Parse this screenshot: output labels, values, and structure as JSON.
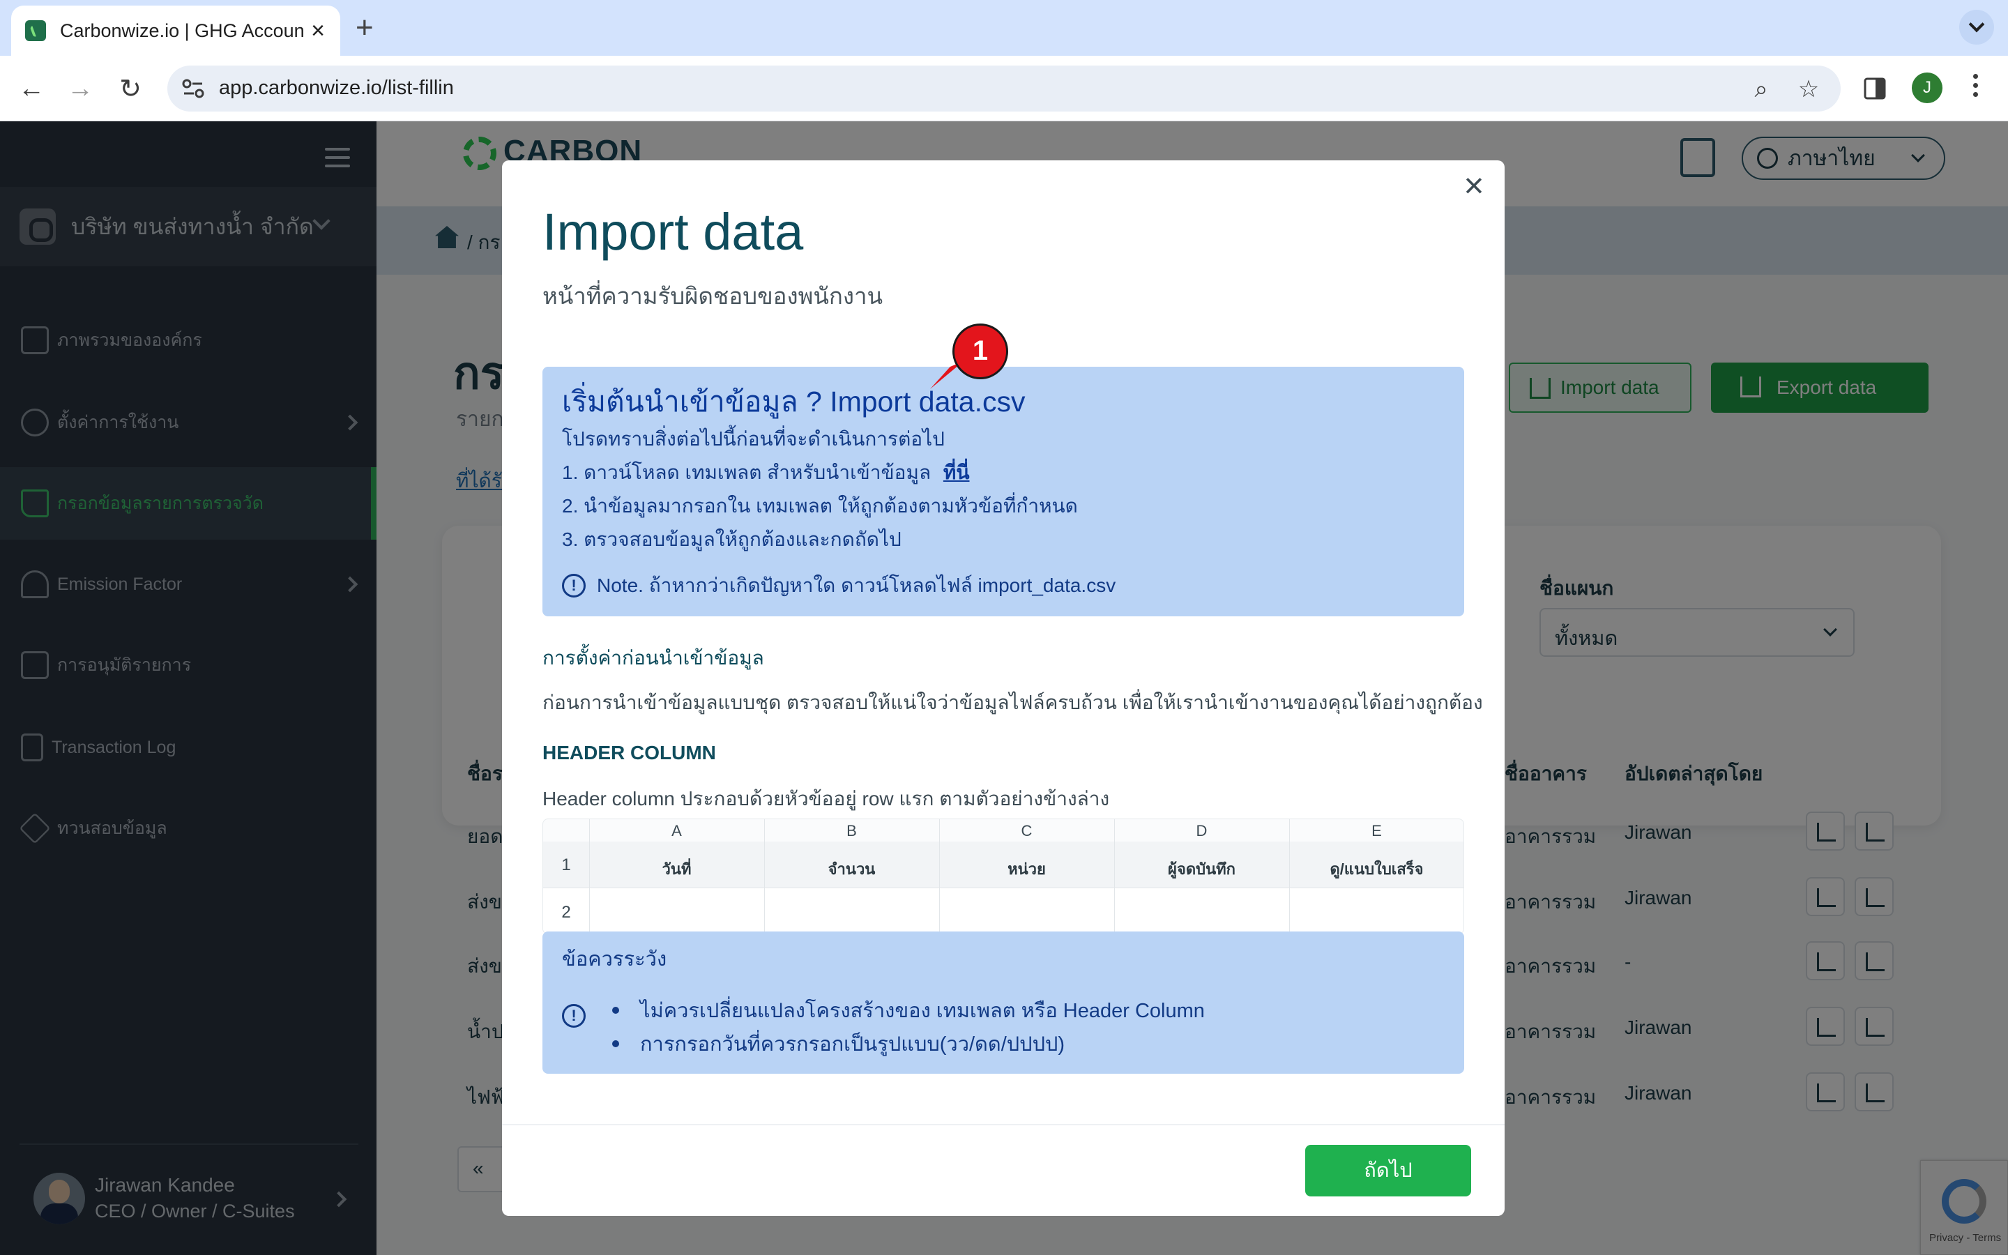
{
  "browser": {
    "tab_title": "Carbonwize.io | GHG Accoun",
    "url": "app.carbonwize.io/list-fillin",
    "profile_initial": "J"
  },
  "sidebar": {
    "company": "บริษัท ขนส่งทางน้ำ จำกัด",
    "items": [
      {
        "label": "ภาพรวมขององค์กร",
        "has_arrow": false
      },
      {
        "label": "ตั้งค่าการใช้งาน",
        "has_arrow": true
      },
      {
        "label": "กรอกข้อมูลรายการตรวจวัด",
        "has_arrow": false,
        "active": true
      },
      {
        "label": "Emission Factor",
        "has_arrow": true
      },
      {
        "label": "การอนุมัติรายการ",
        "has_arrow": false
      },
      {
        "label": "Transaction Log",
        "has_arrow": false
      },
      {
        "label": "ทวนสอบข้อมูล",
        "has_arrow": false
      }
    ],
    "user": {
      "name": "Jirawan Kandee",
      "role": "CEO / Owner / C-Suites"
    }
  },
  "header": {
    "brand": "CARBON",
    "language": "ภาษาไทย",
    "breadcrumb": "/ กร"
  },
  "page": {
    "title": "กร",
    "subtitle": "รายก",
    "link": "ที่ได้รับ",
    "import_button": "Import data",
    "export_button": "Export data",
    "filter_label": "ชื่อแผนก",
    "filter_value": "ทั้งหมด",
    "columns": [
      "ชื่อรา",
      "ชื่ออาคาร",
      "อัปเดตล่าสุดโดย"
    ],
    "rows": [
      {
        "name": "ยอด",
        "building": "อาคารรวม",
        "updated_by": "Jirawan"
      },
      {
        "name": "ส่งข",
        "building": "อาคารรวม",
        "updated_by": "Jirawan"
      },
      {
        "name": "ส่งข",
        "building": "อาคารรวม",
        "updated_by": "-"
      },
      {
        "name": "น้ำป",
        "building": "อาคารรวม",
        "updated_by": "Jirawan"
      },
      {
        "name": "ไฟฟ้",
        "building": "อาคารรวม",
        "updated_by": "Jirawan"
      }
    ],
    "pager_first": "«"
  },
  "modal": {
    "title": "Import data",
    "subtitle": "หน้าที่ความรับผิดชอบของพนักงาน",
    "info": {
      "title": "เริ่มต้นนำเข้าข้อมูล ? Import data.csv",
      "intro": "โปรดทราบสิ่งต่อไปนี้ก่อนที่จะดำเนินการต่อไป",
      "step1": "1. ดาวน์โหลด เทมเพลต สำหรับนำเข้าข้อมูล",
      "step1_link": "ที่นี่",
      "step2": "2. นำข้อมูลมากรอกใน เทมเพลต ให้ถูกต้องตามหัวข้อที่กำหนด",
      "step3": "3. ตรวจสอบข้อมูลให้ถูกต้องและกดถัดไป",
      "note": "Note. ถ้าหากว่าเกิดปัญหาใด ดาวน์โหลดไฟล์ import_data.csv"
    },
    "marker": "1",
    "settings_title": "การตั้งค่าก่อนนำเข้าข้อมูล",
    "settings_text": "ก่อนการนำเข้าข้อมูลแบบชุด ตรวจสอบให้แน่ใจว่าข้อมูลไฟล์ครบถ้วน เพื่อให้เรานำเข้างานของคุณได้อย่างถูกต้อง",
    "header_column_title": "HEADER COLUMN",
    "header_column_text": "Header column ประกอบด้วยหัวข้ออยู่ row แรก ตามตัวอย่างข้างล่าง",
    "sheet": {
      "letters": [
        "A",
        "B",
        "C",
        "D",
        "E"
      ],
      "row_numbers": [
        "1",
        "2"
      ],
      "headers": [
        "วันที่",
        "จำนวน",
        "หน่วย",
        "ผู้จดบันทึก",
        "ดู/แนบใบเสร็จ"
      ]
    },
    "warning": {
      "title": "ข้อควรระวัง",
      "items": [
        "ไม่ควรเปลี่ยนแปลงโครงสร้างของ เทมเพลต หรือ Header Column",
        "การกรอกวันที่ควรกรอกเป็นรูปแบบ(วว/ดด/ปปปป)"
      ]
    },
    "next_button": "ถัดไป"
  },
  "recaptcha": {
    "text": "Privacy - Terms"
  }
}
